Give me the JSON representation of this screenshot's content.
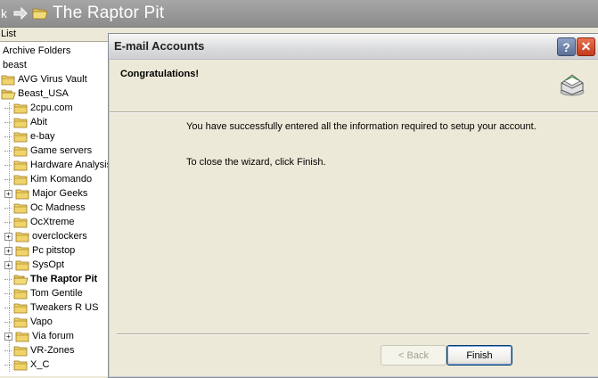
{
  "topbar": {
    "back_fragment": "k",
    "title": "The Raptor Pit"
  },
  "folder_pane": {
    "header": "List",
    "items": [
      {
        "label": "Archive Folders",
        "level": 0,
        "icon": "none",
        "expander": "none"
      },
      {
        "label": "beast",
        "level": 0,
        "icon": "none",
        "expander": "none"
      },
      {
        "label": "AVG Virus Vault",
        "level": 0,
        "icon": "folder-icon",
        "expander": "none"
      },
      {
        "label": "Beast_USA",
        "level": 0,
        "icon": "folder-open-icon",
        "expander": "none"
      },
      {
        "label": "2cpu.com",
        "level": 1,
        "icon": "folder-icon",
        "expander": "none"
      },
      {
        "label": "Abit",
        "level": 1,
        "icon": "folder-icon",
        "expander": "none"
      },
      {
        "label": "e-bay",
        "level": 1,
        "icon": "folder-icon",
        "expander": "none"
      },
      {
        "label": "Game servers",
        "level": 1,
        "icon": "folder-icon",
        "expander": "none"
      },
      {
        "label": "Hardware Analysis",
        "level": 1,
        "icon": "folder-icon",
        "expander": "none"
      },
      {
        "label": "Kim Komando",
        "level": 1,
        "icon": "folder-icon",
        "expander": "none"
      },
      {
        "label": "Major Geeks",
        "level": 1,
        "icon": "folder-icon",
        "expander": "plus"
      },
      {
        "label": "Oc Madness",
        "level": 1,
        "icon": "folder-icon",
        "expander": "none"
      },
      {
        "label": "OcXtreme",
        "level": 1,
        "icon": "folder-icon",
        "expander": "none"
      },
      {
        "label": "overclockers",
        "level": 1,
        "icon": "folder-icon",
        "expander": "plus"
      },
      {
        "label": "Pc pitstop",
        "level": 1,
        "icon": "folder-icon",
        "expander": "plus"
      },
      {
        "label": "SysOpt",
        "level": 1,
        "icon": "folder-icon",
        "expander": "plus"
      },
      {
        "label": "The Raptor Pit",
        "level": 1,
        "icon": "folder-open-icon",
        "expander": "none",
        "selected": true
      },
      {
        "label": "Tom Gentile",
        "level": 1,
        "icon": "folder-icon",
        "expander": "none"
      },
      {
        "label": "Tweakers R US",
        "level": 1,
        "icon": "folder-icon",
        "expander": "none"
      },
      {
        "label": "Vapo",
        "level": 1,
        "icon": "folder-icon",
        "expander": "none"
      },
      {
        "label": "Via forum",
        "level": 1,
        "icon": "folder-icon",
        "expander": "plus"
      },
      {
        "label": "VR-Zones",
        "level": 1,
        "icon": "folder-icon",
        "expander": "none"
      },
      {
        "label": "X_C",
        "level": 1,
        "icon": "folder-icon",
        "expander": "none"
      }
    ]
  },
  "dialog": {
    "title": "E-mail Accounts",
    "help_label": "?",
    "close_label": "✕",
    "heading": "Congratulations!",
    "message_1": "You have successfully entered all the information required to setup your account.",
    "message_2": "To close the wizard, click Finish.",
    "back_label": "< Back",
    "finish_label": "Finish",
    "icon": "mail-icon"
  },
  "colors": {
    "folder": "#e8c95a",
    "folder_edge": "#9a7a1e",
    "close_red": "#c23b1c"
  }
}
